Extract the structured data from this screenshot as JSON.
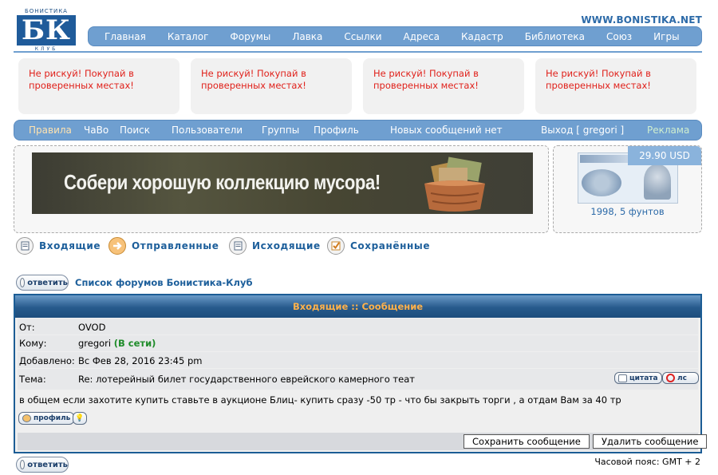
{
  "header": {
    "logo_top": "БОНИСТИКА",
    "logo_main": "БК",
    "logo_bottom": "КЛУБ",
    "site_url": "WWW.BONISTIKA.NET"
  },
  "main_nav": [
    "Главная",
    "Каталог",
    "Форумы",
    "Лавка",
    "Ссылки",
    "Адреса",
    "Кадастр",
    "Библиотека",
    "Союз",
    "Игры"
  ],
  "ads": [
    "Не рискуй! Покупай в проверенных местах!",
    "Не рискуй! Покупай в проверенных местах!",
    "Не рискуй! Покупай в проверенных местах!",
    "Не рискуй! Покупай в проверенных местах!"
  ],
  "sub_nav": {
    "rules": "Правила",
    "faq": "ЧаВо",
    "search": "Поиск",
    "users": "Пользователи",
    "groups": "Группы",
    "profile": "Профиль",
    "new_messages": "Новых сообщений нет",
    "logout": "Выход [ gregori ]",
    "ads": "Реклама"
  },
  "banner": {
    "text": "Собери хорошую коллекцию мусора!"
  },
  "side_ad": {
    "price": "29.90 USD",
    "caption": "1998, 5 фунтов"
  },
  "pm_tabs": {
    "inbox": "Входящие",
    "sent": "Отправленные",
    "outbox": "Исходящие",
    "saved": "Сохранённые"
  },
  "reply_label": "ответить",
  "forum_link": "Список форумов Бонистика-Клуб",
  "message": {
    "title": "Входящие :: Сообщение",
    "from_label": "От:",
    "from_value": "OVOD",
    "to_label": "Кому:",
    "to_value": "gregori",
    "to_status": "(В сети)",
    "date_label": "Добавлено:",
    "date_value": "Вс Фев 28, 2016 23:45 pm",
    "subject_label": "Тема:",
    "subject_value": "Re: лотерейный билет государственного еврейского камерного теат",
    "quote_label": "цитата",
    "pm_label": "лс",
    "body": "в общем если захотите купить ставьте в аукционе Блиц- купить сразу -50 тр - что бы закрыть торги , а отдам Вам за 40 тр",
    "profile_label": "профиль",
    "save_button": "Сохранить сообщение",
    "delete_button": "Удалить сообщение"
  },
  "timezone": "Часовой пояс: GMT + 2"
}
